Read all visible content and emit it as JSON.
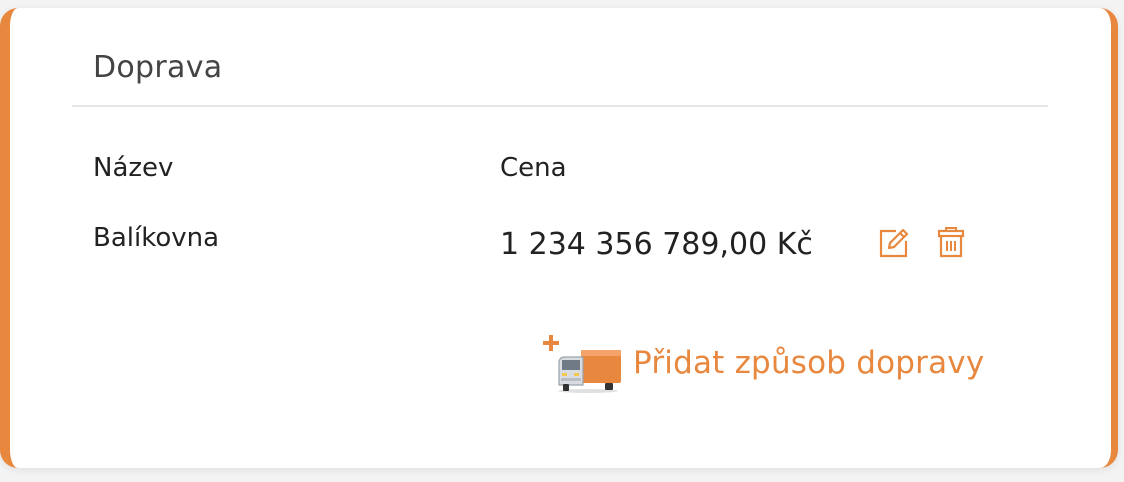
{
  "section": {
    "title": "Doprava"
  },
  "table": {
    "headers": [
      "Název",
      "Cena"
    ],
    "rows": [
      {
        "name": "Balíkovna",
        "price": "1 234 356 789,00 Kč"
      }
    ]
  },
  "actions": {
    "add_label": "Přidat způsob dopravy",
    "edit_icon": "edit-icon",
    "delete_icon": "trash-icon",
    "add_icon": "truck-plus-icon"
  },
  "colors": {
    "accent": "#e8883f",
    "text": "#222222",
    "title": "#444444",
    "divider": "#e6e6e6"
  }
}
